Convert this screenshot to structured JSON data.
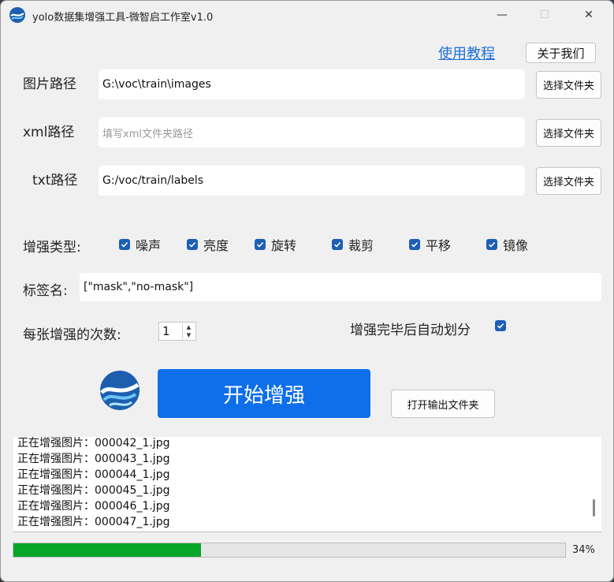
{
  "window": {
    "title": "yolo数据集增强工具-微智启工作室v1.0",
    "minimize": "—",
    "maximize": "☐",
    "close": "✕"
  },
  "header": {
    "tutorial_link": "使用教程",
    "about_button": "关于我们"
  },
  "paths": {
    "image_label": "图片路径",
    "image_value": "G:\\voc\\train\\images",
    "xml_label": "xml路径",
    "xml_placeholder": "填写xml文件夹路径",
    "txt_label": "txt路径",
    "txt_value": "G:/voc/train/labels",
    "browse_label": "选择文件夹"
  },
  "augment": {
    "label": "增强类型:",
    "options": [
      {
        "label": "噪声",
        "checked": true
      },
      {
        "label": "亮度",
        "checked": true
      },
      {
        "label": "旋转",
        "checked": true
      },
      {
        "label": "裁剪",
        "checked": true
      },
      {
        "label": "平移",
        "checked": true
      },
      {
        "label": "镜像",
        "checked": true
      }
    ]
  },
  "tags": {
    "label": "标签名:",
    "value": "[\"mask\",\"no-mask\"]"
  },
  "count": {
    "label": "每张增强的次数:",
    "value": "1"
  },
  "auto_split": {
    "label": "增强完毕后自动划分",
    "checked": true
  },
  "actions": {
    "start": "开始增强",
    "open_output": "打开输出文件夹"
  },
  "log": [
    "正在增强图片：000042_1.jpg",
    "正在增强图片：000043_1.jpg",
    "正在增强图片：000044_1.jpg",
    "正在增强图片：000045_1.jpg",
    "正在增强图片：000046_1.jpg",
    "正在增强图片：000047_1.jpg"
  ],
  "progress": {
    "fraction": 0.34,
    "text": "34%"
  },
  "colors": {
    "accent": "#0f6fea",
    "checkbox": "#1c5fb5",
    "progress": "#07a52a"
  }
}
